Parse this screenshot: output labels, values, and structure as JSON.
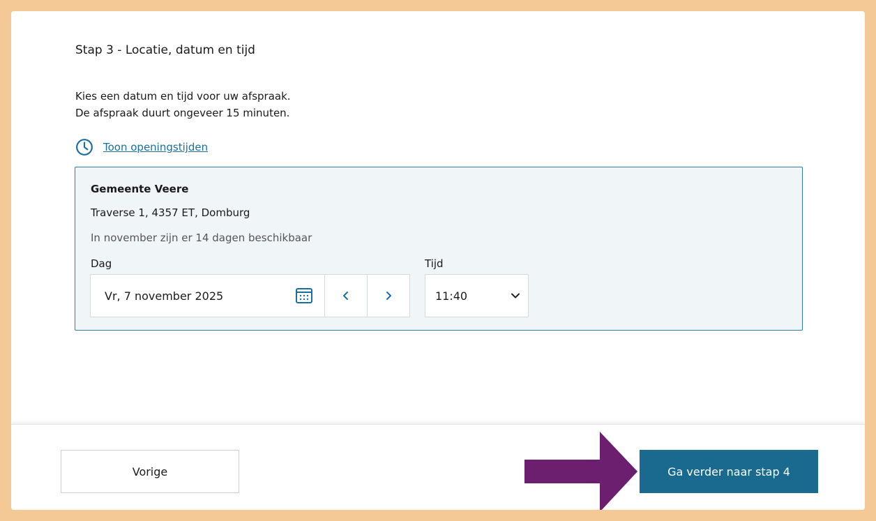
{
  "step": {
    "title": "Stap 3 - Locatie, datum en tijd"
  },
  "intro": {
    "line1": "Kies een datum en tijd voor uw afspraak.",
    "line2": "De afspraak duurt ongeveer 15 minuten."
  },
  "opening_hours": {
    "icon": "clock-icon",
    "link_label": "Toon openingstijden"
  },
  "location": {
    "name": "Gemeente Veere",
    "address": "Traverse 1, 4357 ET, Domburg",
    "availability": "In november zijn er 14 dagen beschikbaar",
    "day_label": "Dag",
    "day_value": "Vr, 7 november 2025",
    "time_label": "Tijd",
    "time_value": "11:40"
  },
  "footer": {
    "back_label": "Vorige",
    "next_label": "Ga verder naar stap 4"
  },
  "colors": {
    "frame": "#f5c995",
    "accent": "#1a6a8f",
    "link": "#1b6fa0",
    "card_bg": "#f0f5f8",
    "arrow": "#6b1f6e"
  }
}
